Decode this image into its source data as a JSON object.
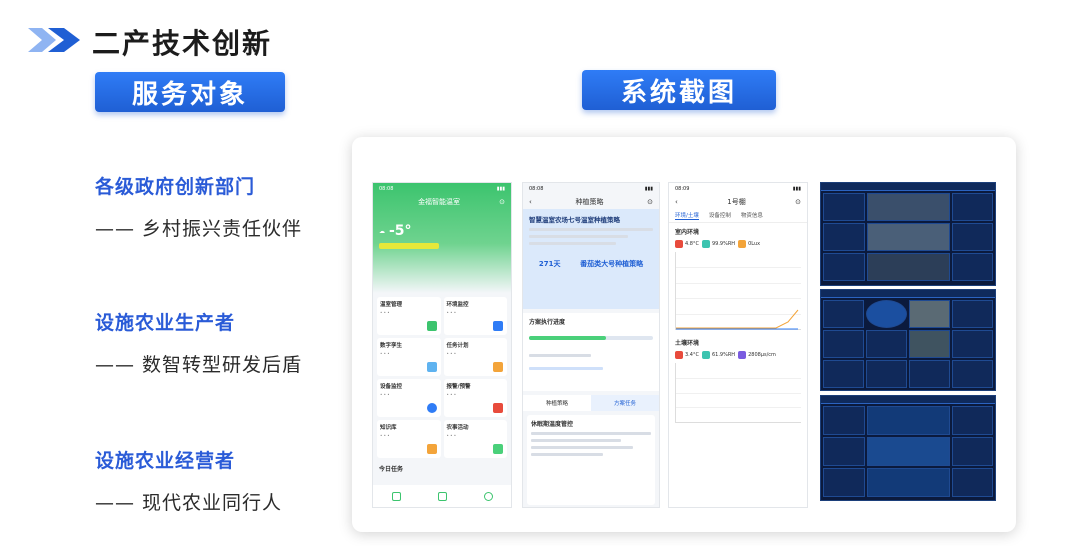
{
  "header": {
    "title": "二产技术创新",
    "accent_color": "#2a6ae0"
  },
  "labels": {
    "service_target": "服务对象",
    "system_screenshot": "系统截图"
  },
  "groups": [
    {
      "title": "各级政府创新部门",
      "subtitle": "—— 乡村振兴责任伙伴"
    },
    {
      "title": "设施农业生产者",
      "subtitle": "—— 数智转型研发后盾"
    },
    {
      "title": "设施农业经营者",
      "subtitle": "—— 现代农业同行人"
    }
  ],
  "screens": {
    "phone1": {
      "status": "08:08",
      "title": "金福智能温室",
      "temp": "-5°",
      "cards": [
        "温室管理",
        "环境监控",
        "数字孪生",
        "任务计划",
        "设备监控",
        "报警/预警",
        "知识库",
        "农事活动"
      ],
      "today": "今日任务"
    },
    "phone2": {
      "status": "08:08",
      "title": "种植策略",
      "heading": "智慧温室农场七号温室种植策略",
      "days": "271天",
      "status_label": "番茄类大号种植策略",
      "progress_title": "方案执行进度",
      "tab_a": "种植策略",
      "tab_b": "方案任务",
      "task_title": "休眠期温度管控"
    },
    "phone3": {
      "status": "08:09",
      "title": "1号棚",
      "tabs": [
        "环境/土壤",
        "设备控制",
        "物资信息"
      ],
      "air_title": "室内环境",
      "air_values": [
        "4.8°C",
        "99.9%RH",
        "0Lux"
      ],
      "soil_title": "土壤环境",
      "soil_values": [
        "3.4°C",
        "61.9%RH",
        "2808μs/cm"
      ]
    }
  }
}
